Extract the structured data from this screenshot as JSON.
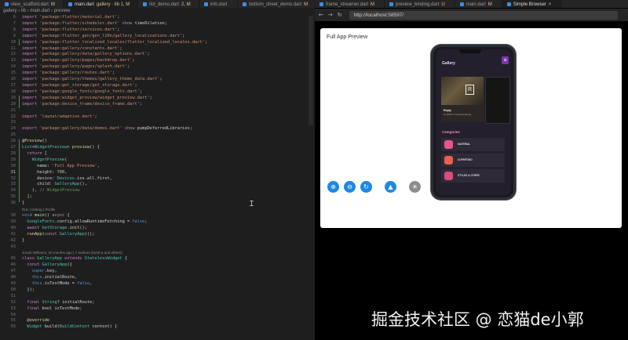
{
  "editor": {
    "tabs": [
      {
        "label": "view_scaffold.dart",
        "mod": "M",
        "active": false
      },
      {
        "label": "main.dart",
        "mod": "gallery · lib 1, M",
        "active": true
      },
      {
        "label": "list_demo.dart",
        "mod": "2, M",
        "active": false
      },
      {
        "label": "info.dart",
        "mod": "",
        "active": false
      },
      {
        "label": "bottom_sheet_demo.dart",
        "mod": "M",
        "active": false
      }
    ],
    "breadcrumb": [
      "gallery",
      "lib",
      "main.dart",
      "preview"
    ],
    "code_lines": [
      {
        "n": "6",
        "t": "import 'package:flutter/material.dart';"
      },
      {
        "n": "7",
        "t": "import 'package:flutter/scheduler.dart' show timeDilation;"
      },
      {
        "n": "8",
        "t": "import 'package:flutter/services.dart';"
      },
      {
        "n": "9",
        "t": "import 'package:flutter_gen/gen_l10n/gallery_localizations.dart';"
      },
      {
        "n": "10",
        "t": "import 'package:flutter_localized_locales/flutter_localized_locales.dart';"
      },
      {
        "n": "11",
        "t": "import 'package:gallery/constants.dart';"
      },
      {
        "n": "12",
        "t": "import 'package:gallery/data/gallery_options.dart';"
      },
      {
        "n": "13",
        "t": "import 'package:gallery/pages/backdrop.dart';"
      },
      {
        "n": "14",
        "t": "import 'package:gallery/pages/splash.dart';"
      },
      {
        "n": "15",
        "t": "import 'package:gallery/routes.dart';"
      },
      {
        "n": "16",
        "t": "import 'package:gallery/themes/gallery_theme_data.dart';"
      },
      {
        "n": "17",
        "t": "import 'package:get_storage/get_storage.dart';"
      },
      {
        "n": "18",
        "t": "import 'package:google_fonts/google_fonts.dart';"
      },
      {
        "n": "19",
        "t": "import 'package:widget_preview/widget_preview.dart';"
      },
      {
        "n": "20",
        "t": "import 'package:device_frame/device_frame.dart';"
      },
      {
        "n": "21",
        "t": ""
      },
      {
        "n": "22",
        "t": "import 'layout/adaptive.dart';"
      },
      {
        "n": "23",
        "t": ""
      },
      {
        "n": "24",
        "t": "export 'package:gallery/data/demos.dart' show pumpDeferredLibraries;"
      },
      {
        "n": "25",
        "t": ""
      },
      {
        "n": "26",
        "t": "@Preview()"
      },
      {
        "n": "27",
        "t": "List<WidgetPreview> preview() {"
      },
      {
        "n": "28",
        "t": "  return ["
      },
      {
        "n": "29",
        "t": "    WidgetPreview("
      },
      {
        "n": "30",
        "t": "      name: 'Full App Preview',"
      },
      {
        "n": "31",
        "t": "      height: 700,"
      },
      {
        "n": "32",
        "t": "      device: Devices.ios.all.first,"
      },
      {
        "n": "33",
        "t": "      child: GalleryApp(),"
      },
      {
        "n": "34",
        "t": "    ), // WidgetPreview"
      },
      {
        "n": "35",
        "t": "  ];"
      },
      {
        "n": "36",
        "t": "}"
      },
      {
        "n": "",
        "t": "Run | Debug | Profile",
        "lens": true
      },
      {
        "n": "38",
        "t": "void main() async {"
      },
      {
        "n": "39",
        "t": "  GoogleFonts.config.allowRuntimeFetching = false;"
      },
      {
        "n": "40",
        "t": "  await GetStorage.init();"
      },
      {
        "n": "41",
        "t": "  runApp(const GalleryApp());"
      },
      {
        "n": "42",
        "t": "}"
      },
      {
        "n": "43",
        "t": ""
      },
      {
        "n": "",
        "t": "Jonah Williams, 20 months ago | 7 authors (larsk-a and others)",
        "lens": true
      },
      {
        "n": "45",
        "t": "class GalleryApp extends StatelessWidget {"
      },
      {
        "n": "46",
        "t": "  const GalleryApp({"
      },
      {
        "n": "47",
        "t": "    super.key,"
      },
      {
        "n": "48",
        "t": "    this.initialRoute,"
      },
      {
        "n": "49",
        "t": "    this.isTestMode = false,"
      },
      {
        "n": "50",
        "t": "  });"
      },
      {
        "n": "51",
        "t": ""
      },
      {
        "n": "52",
        "t": "  final String? initialRoute;"
      },
      {
        "n": "53",
        "t": "  final bool isTestMode;"
      },
      {
        "n": "54",
        "t": ""
      },
      {
        "n": "55",
        "t": "  @override"
      },
      {
        "n": "56",
        "t": "  Widget build(BuildContext context) {"
      }
    ]
  },
  "browser": {
    "tabs": [
      {
        "label": "frame_streamer.dart",
        "mod": "M"
      },
      {
        "label": "preview_binding.dart",
        "mod": "U"
      },
      {
        "label": "main.dart",
        "mod": "M"
      },
      {
        "label": "Simple Browser",
        "mod": "×"
      }
    ],
    "url": "http://localhost:58597/",
    "preview_title": "Full App Preview",
    "app": {
      "title": "Gallery",
      "card_title": "Reply",
      "card_subtitle": "An efficient, focused email app",
      "categories_title": "Categories",
      "categories": [
        {
          "label": "MATERIAL",
          "color": "#e6578f"
        },
        {
          "label": "CUPERTINO",
          "color": "#e8604d"
        },
        {
          "label": "STYLES & OTHER",
          "color": "#d94c7e"
        }
      ]
    },
    "tools": [
      "zoom-in-icon",
      "zoom-out-icon",
      "refresh-icon",
      "landscape-icon",
      "brightness-icon"
    ]
  },
  "watermark": "掘金技术社区 @ 恋猫de小郭"
}
